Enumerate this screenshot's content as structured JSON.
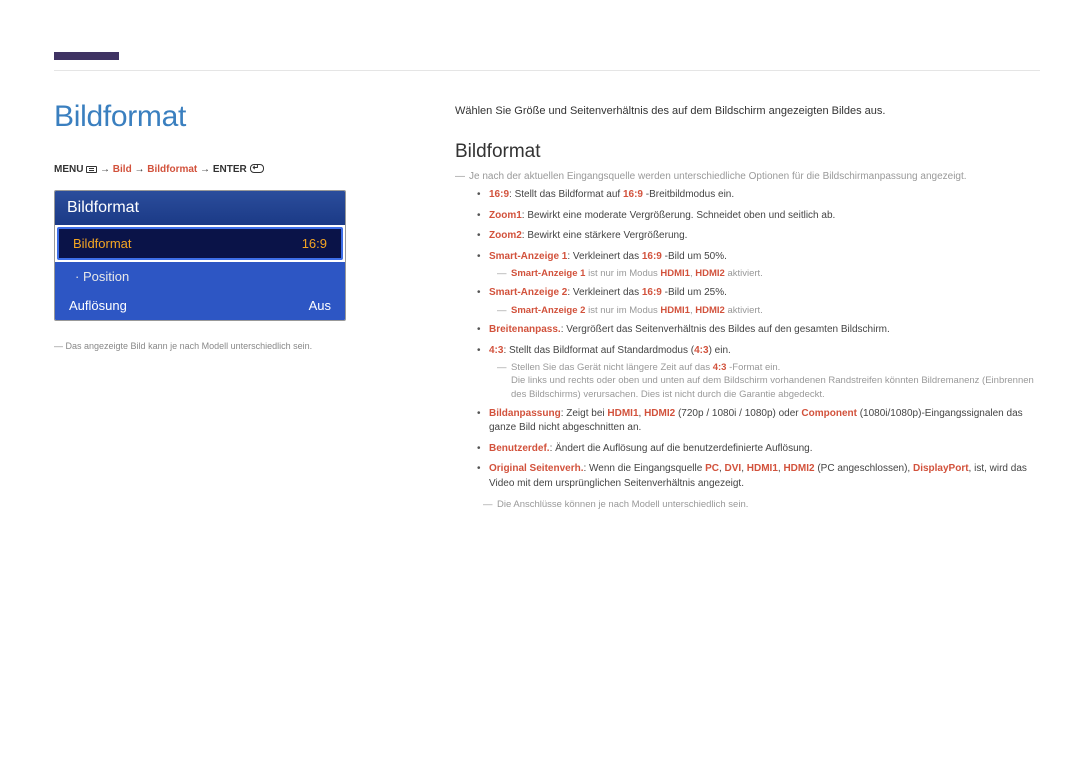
{
  "page": {
    "title": "Bildformat",
    "breadcrumb": {
      "menu": "MENU",
      "step1": "Bild",
      "step2": "Bildformat",
      "enter": "ENTER"
    },
    "panel": {
      "title": "Bildformat",
      "rows": [
        {
          "label": "Bildformat",
          "value": "16:9",
          "type": "selected"
        },
        {
          "label": "Position",
          "value": "",
          "type": "sub"
        },
        {
          "label": "Auflösung",
          "value": "Aus",
          "type": "normal"
        }
      ],
      "disclaimer": "Das angezeigte Bild kann je nach Modell unterschiedlich sein."
    }
  },
  "content": {
    "intro": "Wählen Sie Größe und Seitenverhältnis des auf dem Bildschirm angezeigten Bildes aus.",
    "heading": "Bildformat",
    "topnote": "Je nach der aktuellen Eingangsquelle werden unterschiedliche Optionen für die Bildschirmanpassung angezeigt.",
    "items": {
      "b1": {
        "hl": "16:9",
        "text": ": Stellt das Bildformat auf ",
        "hl2": "16:9",
        "tail": " -Breitbildmodus ein."
      },
      "b2": {
        "hl": "Zoom1",
        "text": ": Bewirkt eine moderate Vergrößerung. Schneidet oben und seitlich ab."
      },
      "b3": {
        "hl": "Zoom2",
        "text": ": Bewirkt eine stärkere Vergrößerung."
      },
      "b4": {
        "hl": "Smart-Anzeige 1",
        "text": ": Verkleinert das ",
        "hl2": "16:9",
        "tail": " -Bild um 50%."
      },
      "b4sub": {
        "hl1": "Smart-Anzeige 1",
        "mid": " ist nur im Modus ",
        "hl2": "HDMI1",
        "hl3": "HDMI2",
        "tail": " aktiviert."
      },
      "b5": {
        "hl": "Smart-Anzeige 2",
        "text": ": Verkleinert das ",
        "hl2": "16:9",
        "tail": " -Bild um 25%."
      },
      "b5sub": {
        "hl1": "Smart-Anzeige 2",
        "mid": "  ist nur im Modus  ",
        "hl2": "HDMI1",
        "hl3": "HDMI2",
        "tail": " aktiviert."
      },
      "b6": {
        "hl": "Breitenanpass.",
        "text": ": Vergrößert das Seitenverhältnis des Bildes auf den gesamten Bildschirm."
      },
      "b7": {
        "hl": "4:3",
        "text": ": Stellt das Bildformat auf Standardmodus (",
        "hl2": "4:3",
        "tail": ") ein."
      },
      "b7sub1": {
        "pre": "Stellen Sie das Gerät nicht längere Zeit auf das ",
        "hl": "4:3",
        "post": " -Format ein."
      },
      "b7sub2": "Die links und rechts oder oben und unten auf dem Bildschirm vorhandenen Randstreifen könnten Bildremanenz (Einbrennen des Bildschirms) verursachen. Dies ist nicht durch die Garantie abgedeckt.",
      "b8": {
        "hl": "Bildanpassung",
        "t1": ": Zeigt bei ",
        "h1": "HDMI1",
        "h2": "HDMI2",
        "t2": " (720p / 1080i / 1080p) oder ",
        "h3": "Component",
        "t3": " (1080i/1080p)-Eingangssignalen das ganze Bild nicht abgeschnitten an."
      },
      "b9": {
        "hl": "Benutzerdef.",
        "text": ": Ändert die Auflösung auf die benutzerdefinierte Auflösung."
      },
      "b10": {
        "hl": "Original Seitenverh.",
        "t1": ": Wenn die Eingangsquelle ",
        "h1": "PC",
        "h2": "DVI",
        "h3": "HDMI1",
        "h4": "HDMI2",
        "t2": " (PC angeschlossen), ",
        "h5": "DisplayPort",
        "t3": ", ist, wird das Video mit dem ursprünglichen Seitenverhältnis angezeigt."
      }
    },
    "finalnote": "Die Anschlüsse können je nach Modell unterschiedlich sein."
  }
}
